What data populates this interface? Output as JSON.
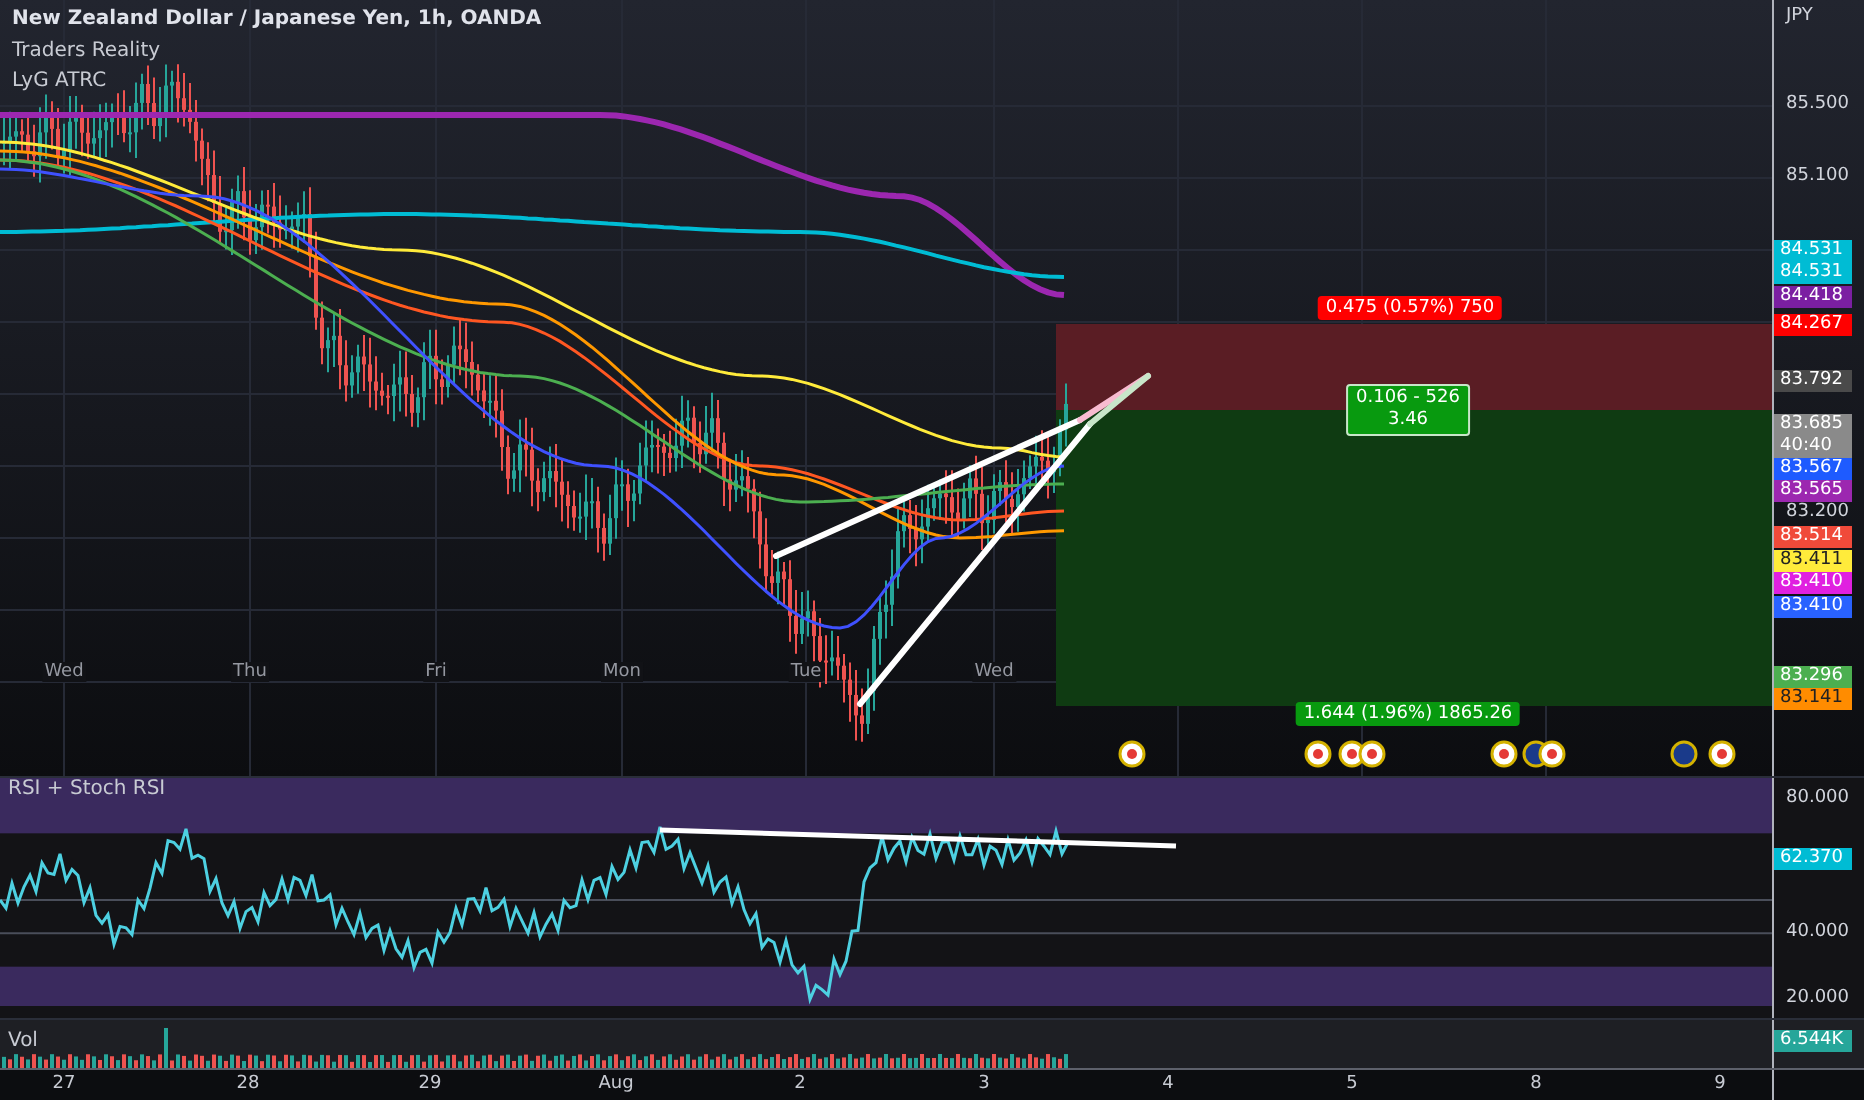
{
  "chart_title": "New Zealand Dollar / Japanese Yen, 1h, OANDA",
  "indicators": [
    "Traders Reality",
    "LyG ATRC"
  ],
  "price_axis": {
    "currency": "JPY",
    "ticks": [
      "85.500",
      "85.100",
      "83.200"
    ],
    "tags": [
      {
        "value": "84.531",
        "color": "#00bcd4"
      },
      {
        "value": "84.531",
        "color": "#00bcd4"
      },
      {
        "value": "84.418",
        "color": "#7b1fa2"
      },
      {
        "value": "84.267",
        "color": "#ff0000"
      },
      {
        "value": "83.792",
        "color": "#4a4a4a"
      },
      {
        "value": "83.685",
        "sub": "40:40",
        "color": "#8a8a8a"
      },
      {
        "value": "83.567",
        "color": "#1e5bff"
      },
      {
        "value": "83.565",
        "color": "#9c27b0"
      },
      {
        "value": "83.514",
        "color": "#f04a3a"
      },
      {
        "value": "83.411",
        "color": "#ffeb3b"
      },
      {
        "value": "83.410",
        "color": "#e020e0"
      },
      {
        "value": "83.410",
        "color": "#2962ff"
      },
      {
        "value": "83.296",
        "color": "#4caf50"
      },
      {
        "value": "83.141",
        "color": "#ff8c00"
      }
    ]
  },
  "day_labels": [
    "Wed",
    "Thu",
    "Fri",
    "Mon",
    "Tue",
    "Wed"
  ],
  "position": {
    "stop_label": "0.475 (0.57%) 750",
    "ratio_label": [
      "0.106 - 526",
      "3.46"
    ],
    "target_label": "1.644 (1.96%) 1865.26"
  },
  "rsi_pane": {
    "title": "RSI + Stoch RSI",
    "ticks": [
      "80.000",
      "40.000",
      "20.000"
    ],
    "tag": {
      "value": "62.370",
      "color": "#00bcd4"
    }
  },
  "volume_pane": {
    "title": "Vol",
    "tag": {
      "value": "6.544K",
      "color": "#26a69a"
    }
  },
  "time_axis": [
    "27",
    "28",
    "29",
    "Aug",
    "2",
    "3",
    "4",
    "5",
    "8",
    "9"
  ]
}
